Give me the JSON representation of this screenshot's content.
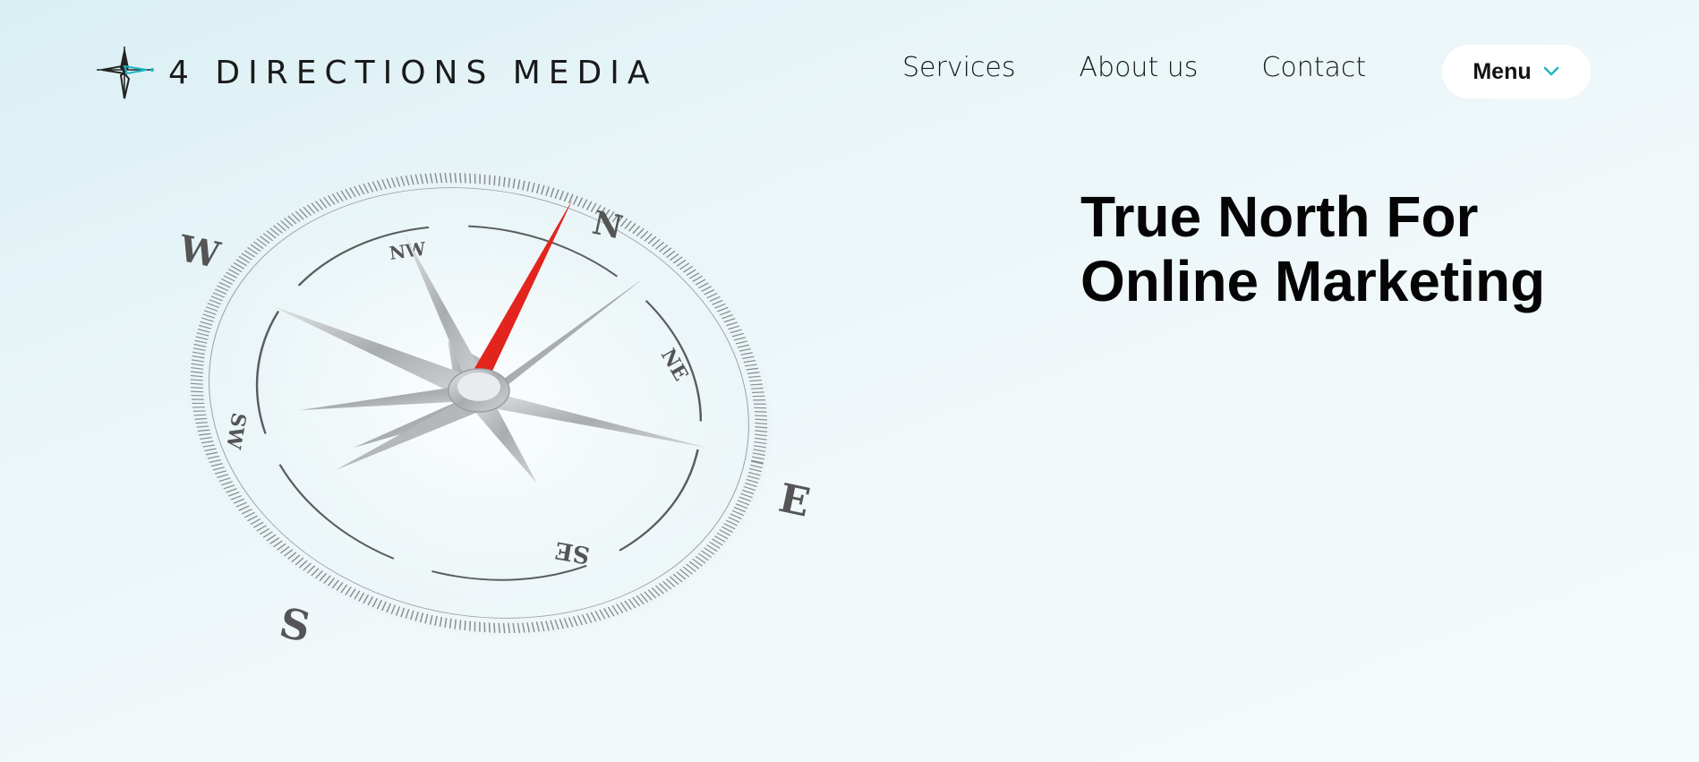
{
  "header": {
    "logo_text": "4 DIRECTIONS MEDIA",
    "logo_icon": "compass-star-logo-icon",
    "nav": [
      {
        "label": "Services"
      },
      {
        "label": "About us"
      },
      {
        "label": "Contact"
      }
    ],
    "menu_label": "Menu",
    "menu_icon": "chevron-down-icon"
  },
  "hero": {
    "title_line1": "True North For",
    "title_line2": "Online Marketing"
  },
  "compass_image": {
    "icon": "compass-illustration",
    "labels": [
      "N",
      "NE",
      "E",
      "SE",
      "S",
      "SW",
      "W",
      "NW"
    ]
  },
  "colors": {
    "accent": "#1fb5c4",
    "needle_red": "#e8201a",
    "background": "#e6f4f7"
  }
}
